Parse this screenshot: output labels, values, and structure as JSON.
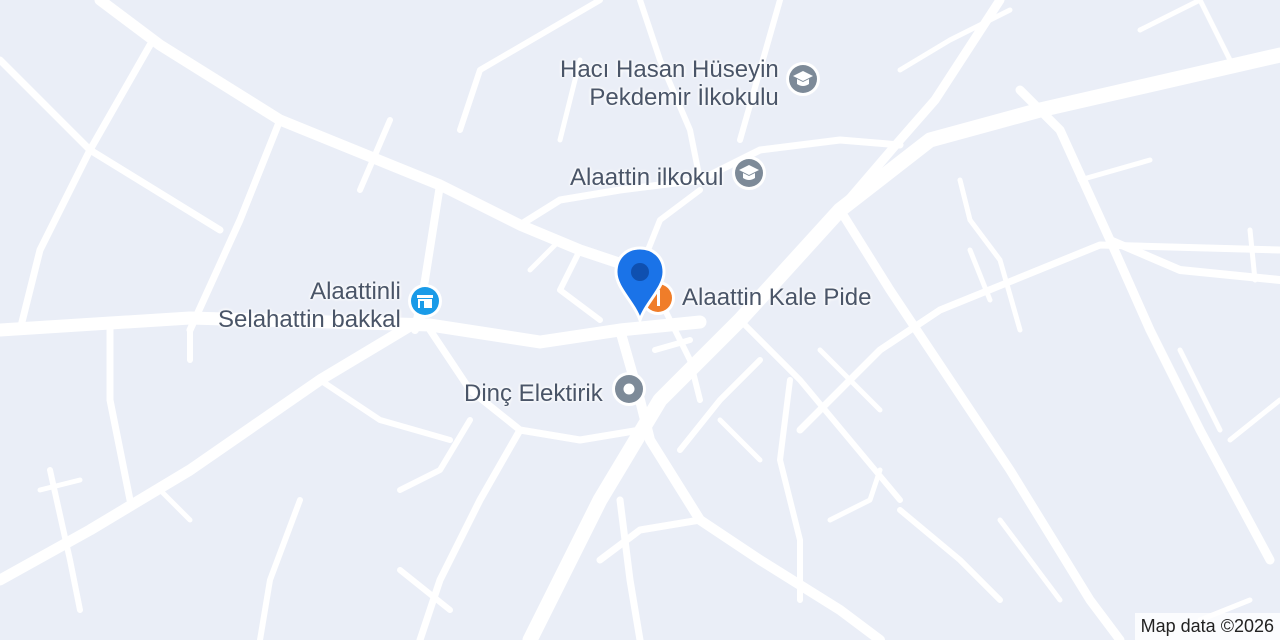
{
  "map": {
    "background": "#eaeef7",
    "road_color": "#ffffff"
  },
  "pois": [
    {
      "lines": [
        "Hacı Hasan Hüseyin",
        "Pekdemir İlkokulu"
      ],
      "icon": "school-icon",
      "color": "#7d8a98"
    },
    {
      "lines": [
        "Alaattin ilkokul"
      ],
      "icon": "school-icon",
      "color": "#7d8a98"
    },
    {
      "lines": [
        "Alaattinli",
        "Selahattin bakkal"
      ],
      "icon": "store-icon",
      "color": "#1a9be8"
    },
    {
      "lines": [
        "Alaattin Kale Pide"
      ],
      "icon": "restaurant-icon",
      "color": "#f07d29"
    },
    {
      "lines": [
        "Dinç Elektirik"
      ],
      "icon": "place-icon",
      "color": "#7d8a98"
    }
  ],
  "selected_marker": {
    "icon": "location-pin-icon",
    "color": "#1a73e8"
  },
  "attribution": "Map data ©2026"
}
